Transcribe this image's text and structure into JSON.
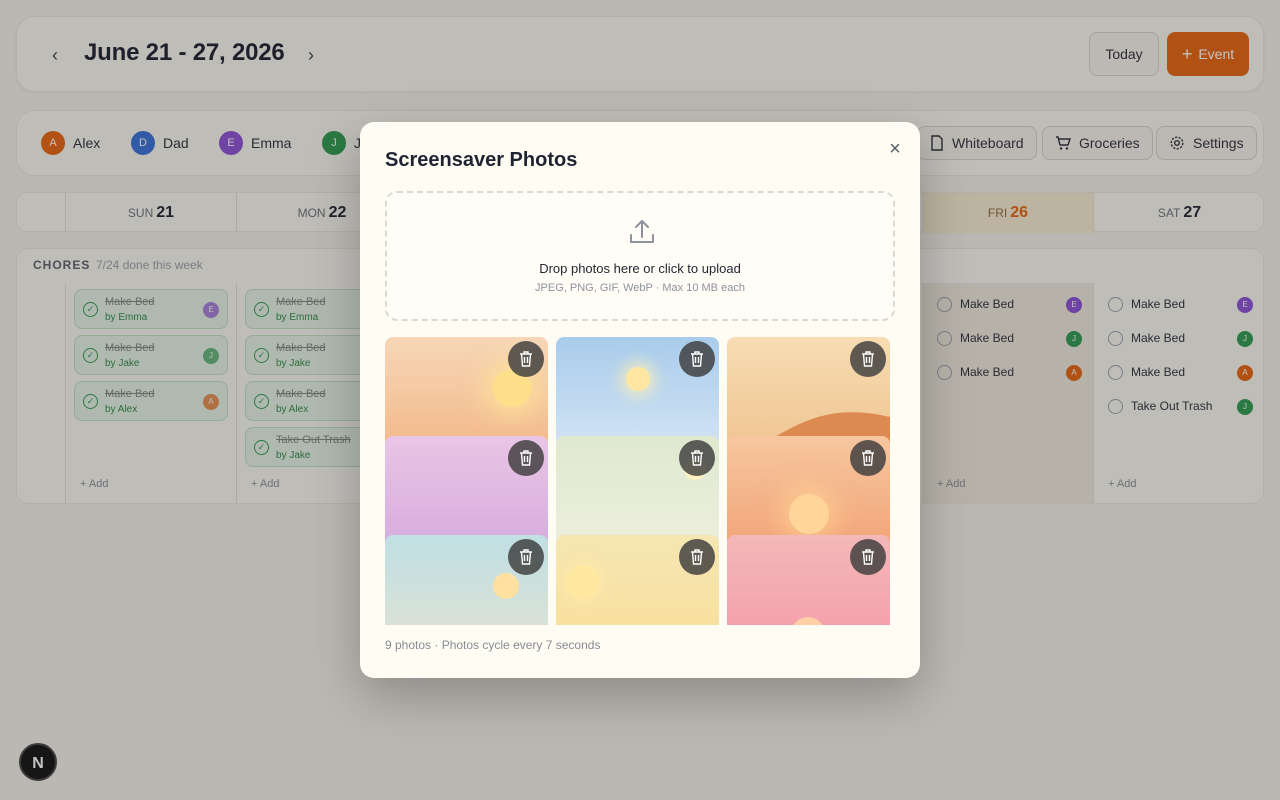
{
  "header": {
    "week_title": "June 21 - 27, 2026",
    "prev_icon": "chevron-left-icon",
    "next_icon": "chevron-right-icon",
    "today_label": "Today",
    "event_label": "Event",
    "accent_color": "#e8650f"
  },
  "members": [
    {
      "initial": "A",
      "name": "Alex",
      "color": "#e8650f"
    },
    {
      "initial": "D",
      "name": "Dad",
      "color": "#3a6fd8"
    },
    {
      "initial": "E",
      "name": "Emma",
      "color": "#8b4fd6"
    },
    {
      "initial": "J",
      "name": "J",
      "color": "#2f9a4e"
    }
  ],
  "tools": {
    "whiteboard": "Whiteboard",
    "groceries": "Groceries",
    "settings": "Settings"
  },
  "days": [
    {
      "dow": "SUN",
      "num": "21"
    },
    {
      "dow": "MON",
      "num": "22"
    },
    {
      "dow": "FRI",
      "num": "26"
    },
    {
      "dow": "SAT",
      "num": "27"
    }
  ],
  "chores": {
    "heading": "CHORES",
    "summary": "7/24 done this week",
    "add_label": "Add",
    "sun": [
      {
        "title": "Make Bed",
        "by": "by Emma",
        "initial": "E"
      },
      {
        "title": "Make Bed",
        "by": "by Jake",
        "initial": "J"
      },
      {
        "title": "Make Bed",
        "by": "by Alex",
        "initial": "A"
      }
    ],
    "mon": [
      {
        "title": "Make Bed",
        "by": "by Emma"
      },
      {
        "title": "Make Bed",
        "by": "by Jake"
      },
      {
        "title": "Make Bed",
        "by": "by Alex"
      },
      {
        "title": "Take Out Trash",
        "by": "by Jake"
      }
    ],
    "fri": [
      {
        "title": "Make Bed",
        "initial": "E"
      },
      {
        "title": "Make Bed",
        "initial": "J"
      },
      {
        "title": "Make Bed",
        "initial": "A"
      }
    ],
    "sat": [
      {
        "title": "Make Bed",
        "initial": "E"
      },
      {
        "title": "Make Bed",
        "initial": "J"
      },
      {
        "title": "Make Bed",
        "initial": "A"
      },
      {
        "title": "Take Out Trash",
        "initial": "J"
      }
    ]
  },
  "modal": {
    "title": "Screensaver Photos",
    "close_icon": "close-icon",
    "drop_main": "Drop photos here or click to upload",
    "drop_sub": "JPEG, PNG, GIF, WebP · Max 10 MB each",
    "upload_icon": "upload-icon",
    "trash_icon": "trash-icon",
    "footer": "9 photos · Photos cycle every 7 seconds",
    "photos": [
      {
        "name": "photo-1",
        "from": "#f6d7b8",
        "to": "#f2a46a",
        "sun": "#ffe08a"
      },
      {
        "name": "photo-2",
        "from": "#a9ccec",
        "to": "#eef4f8",
        "sun": "#ffe7a2"
      },
      {
        "name": "photo-3",
        "from": "#f7dcb3",
        "to": "#e8a868",
        "sun": "#ffe8b5"
      },
      {
        "name": "photo-4",
        "from": "#e9c5e6",
        "to": "#c99ad6",
        "sun": "#f6d8f0"
      },
      {
        "name": "photo-5",
        "from": "#dfe9cf",
        "to": "#f6f3e6",
        "sun": "#fff2c0"
      },
      {
        "name": "photo-6",
        "from": "#f7c7a0",
        "to": "#ee8c5a",
        "sun": "#ffd59a"
      },
      {
        "name": "photo-7",
        "from": "#bfe0e4",
        "to": "#f6e2c7",
        "sun": "#ffe0a0"
      },
      {
        "name": "photo-8",
        "from": "#f5e6b3",
        "to": "#fbd98a",
        "sun": "#ffe8a0"
      },
      {
        "name": "photo-9",
        "from": "#f3b8b8",
        "to": "#f48aa0",
        "sun": "#ffd0a8"
      }
    ]
  }
}
